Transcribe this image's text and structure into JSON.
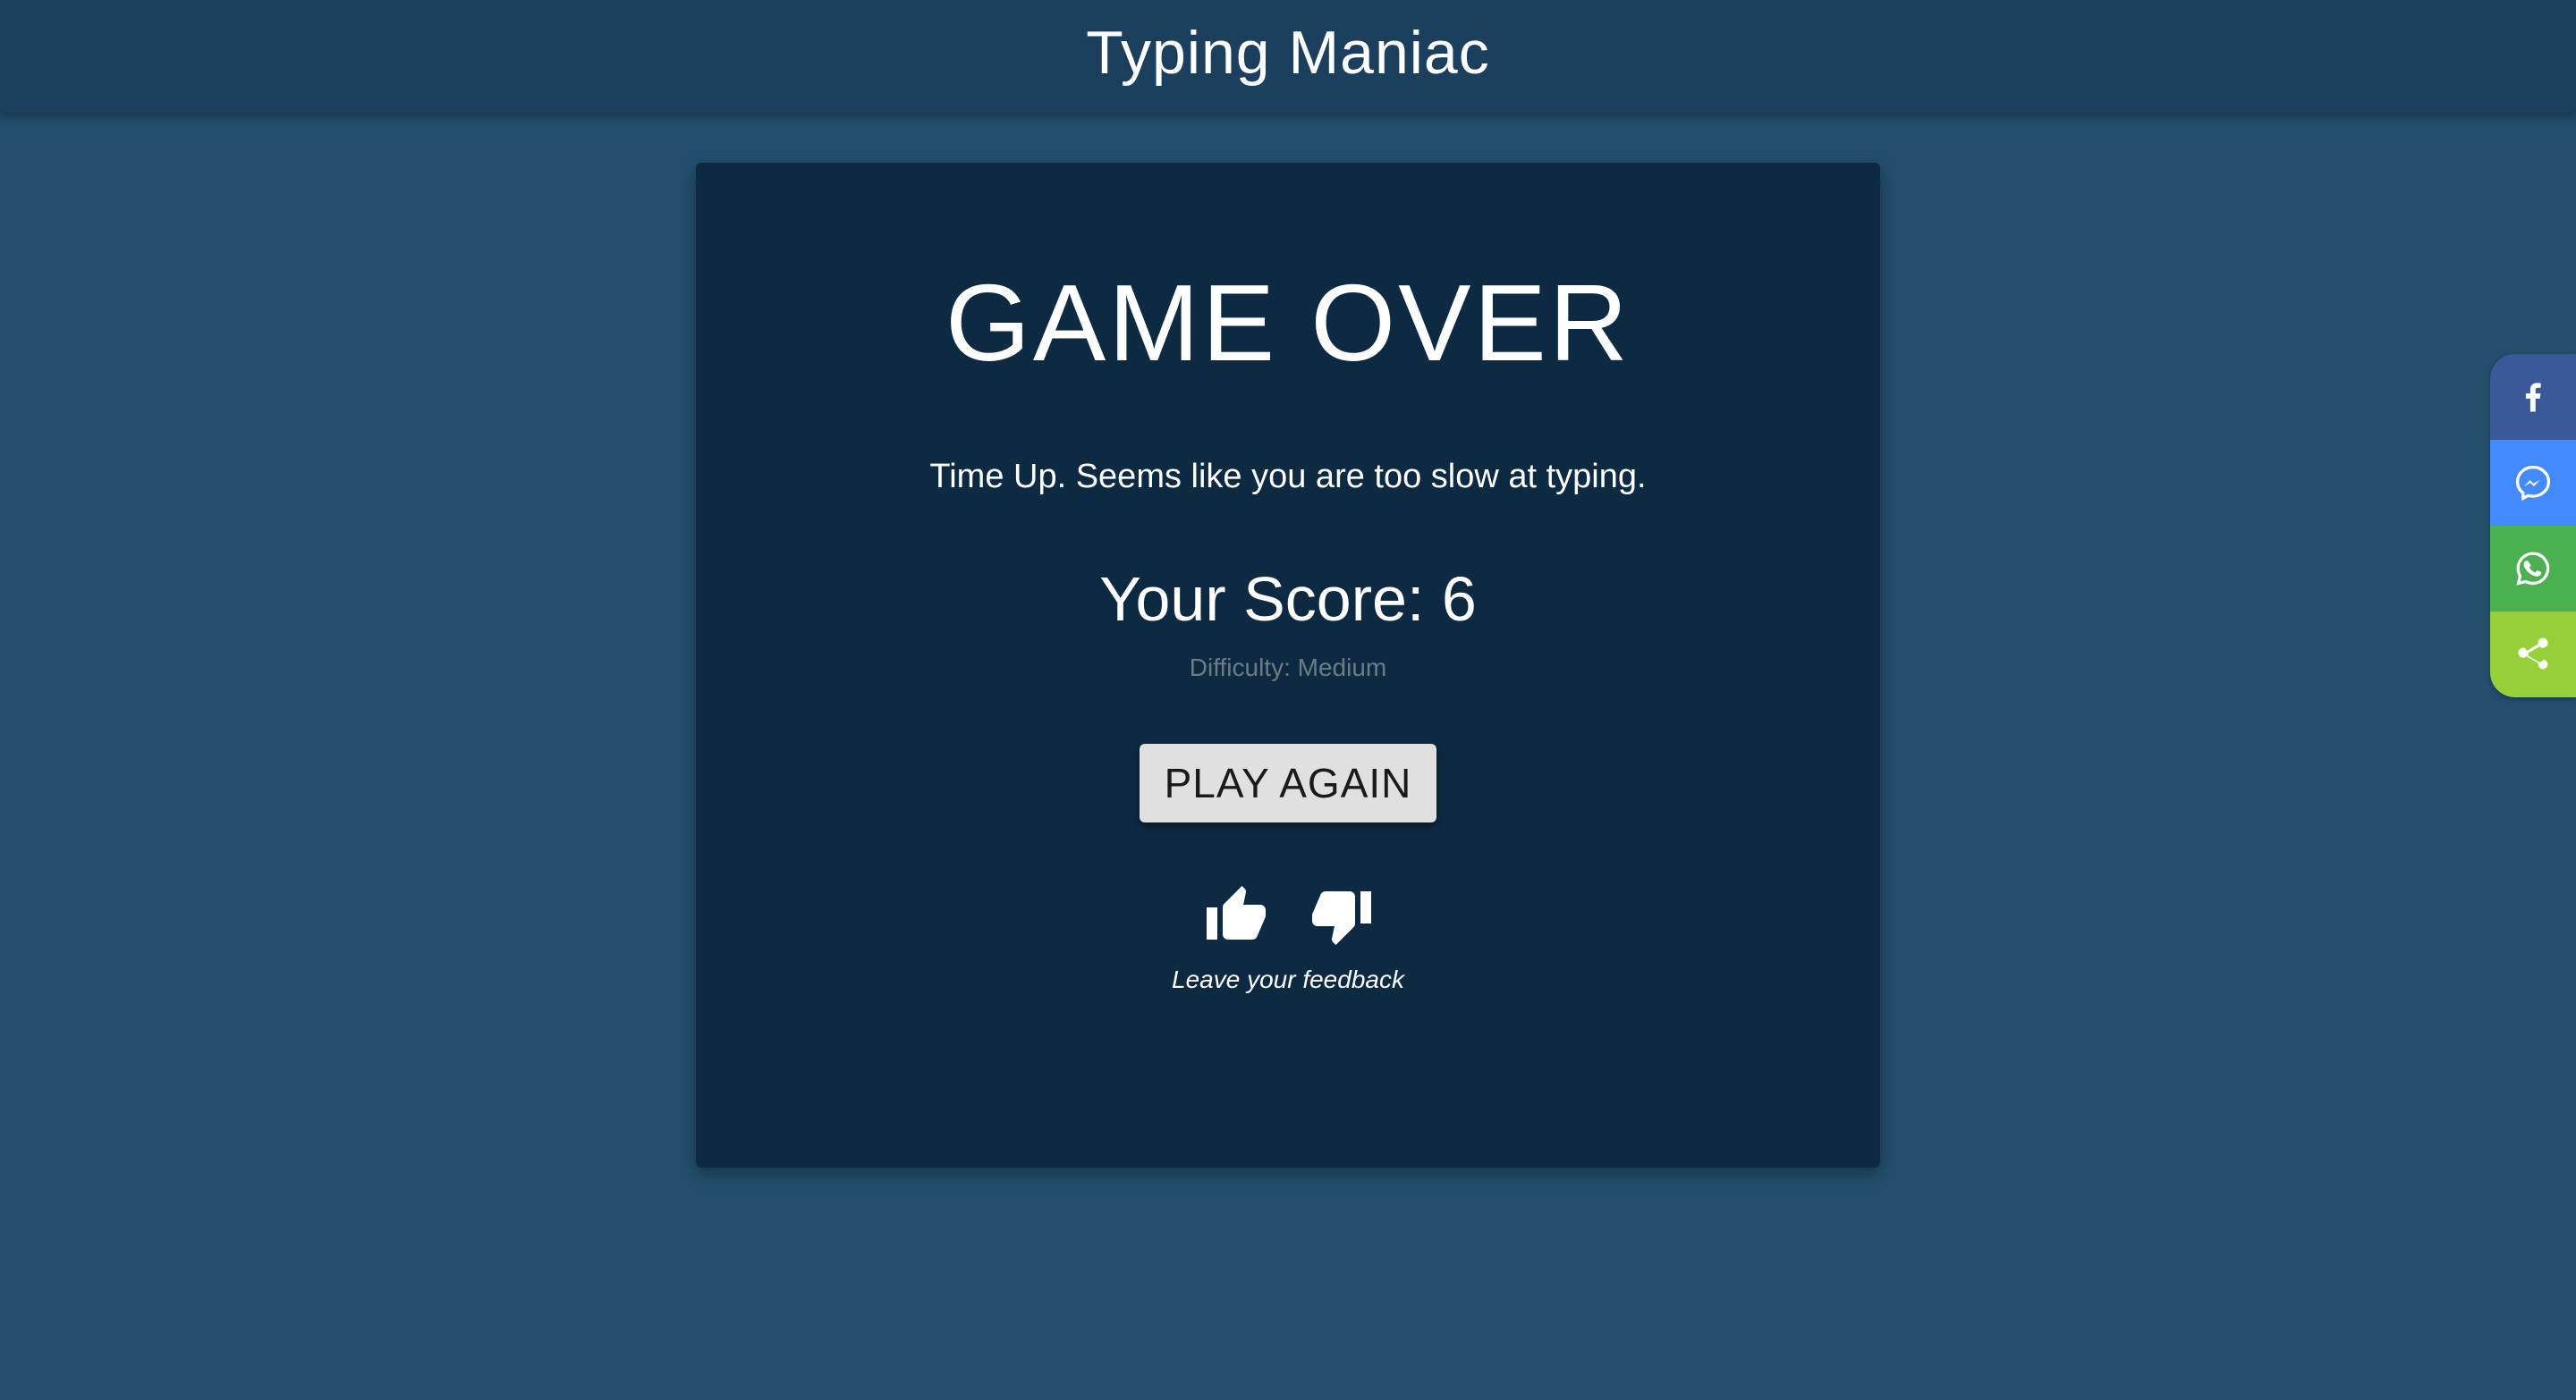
{
  "header": {
    "title": "Typing Maniac"
  },
  "game": {
    "heading": "GAME OVER",
    "message": "Time Up. Seems like you are too slow at typing.",
    "score_text": "Your Score: 6",
    "difficulty_text": "Difficulty: Medium",
    "play_again_label": "PLAY AGAIN",
    "feedback_label": "Leave your feedback"
  },
  "share": {
    "buttons": [
      {
        "icon": "facebook-icon",
        "color": "#3b5998"
      },
      {
        "icon": "messenger-icon",
        "color": "#448aff"
      },
      {
        "icon": "whatsapp-icon",
        "color": "#4caf50"
      },
      {
        "icon": "share-icon",
        "color": "#95d03a"
      }
    ]
  },
  "colors": {
    "page_background": "#234f6d",
    "header_background": "#1b3f5d",
    "card_background": "#0e2a42",
    "button_background": "#e0e0e0"
  }
}
